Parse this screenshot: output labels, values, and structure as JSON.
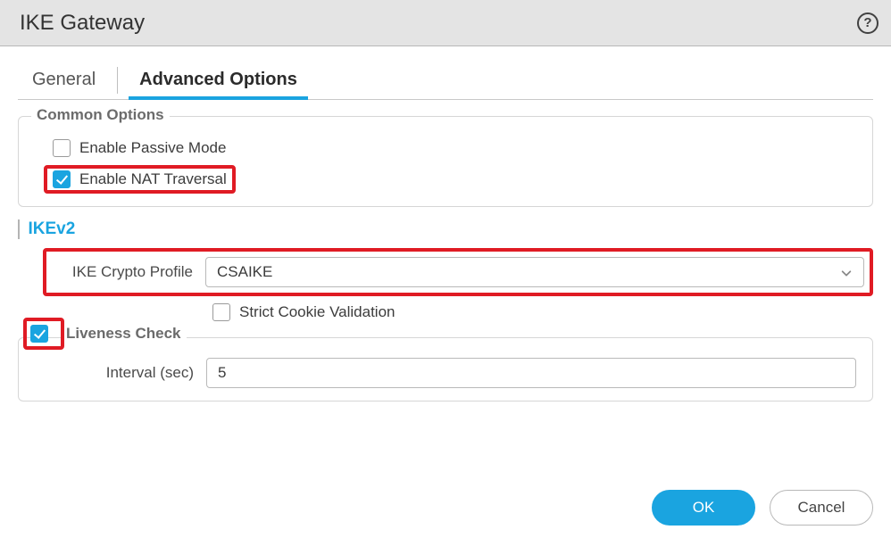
{
  "title": "IKE Gateway",
  "help_glyph": "?",
  "tabs": {
    "general": "General",
    "advanced": "Advanced Options"
  },
  "common_options": {
    "legend": "Common Options",
    "passive_mode": {
      "label": "Enable Passive Mode",
      "checked": false
    },
    "nat_traversal": {
      "label": "Enable NAT Traversal",
      "checked": true
    }
  },
  "ikev2": {
    "heading": "IKEv2",
    "crypto_profile": {
      "label": "IKE Crypto Profile",
      "value": "CSAIKE"
    },
    "strict_cookie": {
      "label": "Strict Cookie Validation",
      "checked": false
    }
  },
  "liveness": {
    "legend": "Liveness Check",
    "checked": true,
    "interval": {
      "label": "Interval (sec)",
      "value": "5"
    }
  },
  "buttons": {
    "ok": "OK",
    "cancel": "Cancel"
  }
}
